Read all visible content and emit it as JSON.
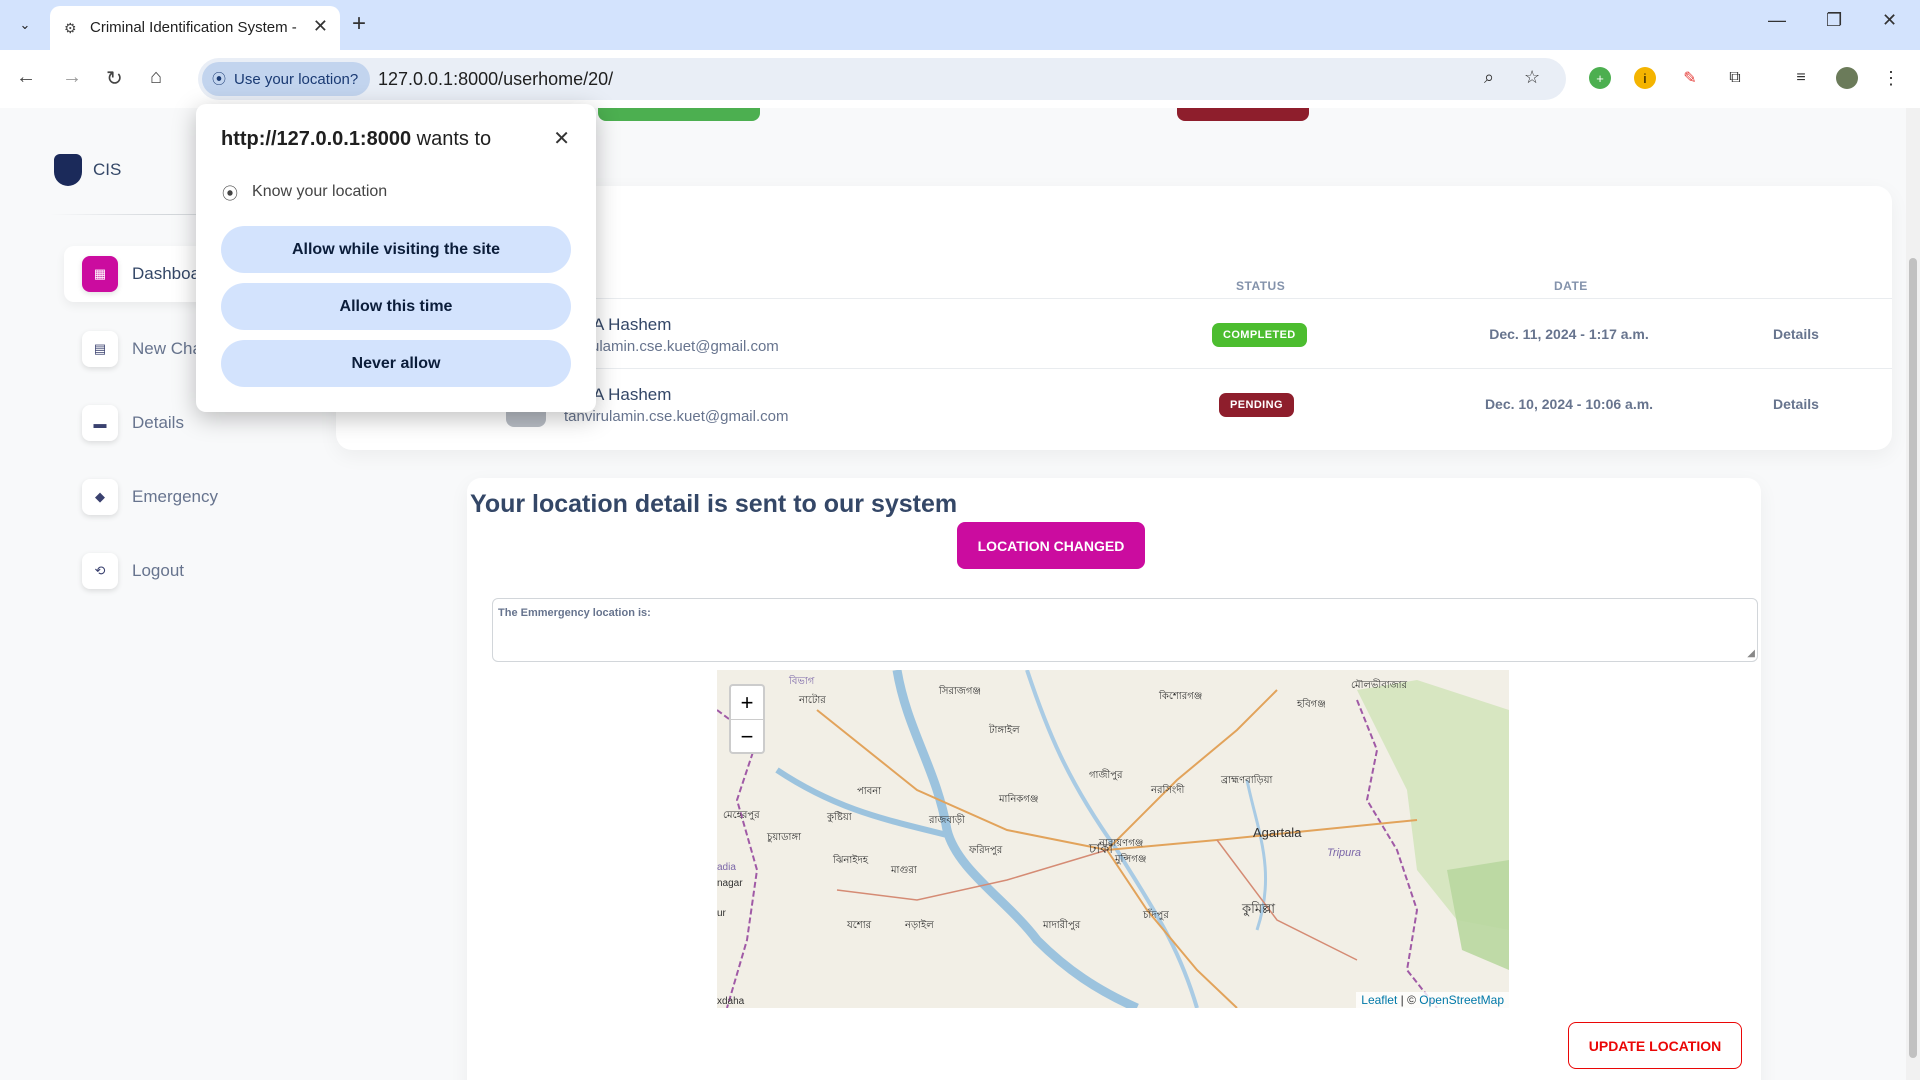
{
  "browser": {
    "tab_title": "Criminal Identification System -",
    "url": "127.0.0.1:8000/userhome/20/",
    "location_chip": "Use your location?"
  },
  "sidebar": {
    "brand": "CIS",
    "items": [
      {
        "label": "Dashboa",
        "icon": "shop-icon",
        "active": true
      },
      {
        "label": "New Cha",
        "icon": "office-icon",
        "active": false
      },
      {
        "label": "Details",
        "icon": "credit-card-icon",
        "active": false
      },
      {
        "label": "Emergency",
        "icon": "box-icon",
        "active": false
      },
      {
        "label": "Logout",
        "icon": "logout-icon",
        "active": false
      }
    ]
  },
  "table": {
    "headers": {
      "status": "STATUS",
      "date": "DATE"
    },
    "rows": [
      {
        "name": "A Hashem",
        "email": "rulamin.cse.kuet@gmail.com",
        "status": "COMPLETED",
        "status_color": "#2dce89",
        "date": "Dec. 11, 2024 - 1:17 a.m.",
        "action": "Details"
      },
      {
        "name": "A Hashem",
        "email": "tanvirulamin.cse.kuet@gmail.com",
        "status": "PENDING",
        "status_color": "#8e1e2c",
        "date": "Dec. 10, 2024 - 10:06 a.m.",
        "action": "Details"
      }
    ]
  },
  "location": {
    "heading": "Your location detail is sent to our system",
    "changed_button": "LOCATION CHANGED",
    "textarea_text": "The Emmergency location is:",
    "update_button": "UPDATE LOCATION"
  },
  "map": {
    "zoom_in": "+",
    "zoom_out": "−",
    "labels": [
      "Agartala",
      "Tripura",
      "ঢাকা",
      "কুমিল্লা",
      "পাবনা",
      "কুষ্টিয়া",
      "টাঙ্গাইল",
      "নাটোর",
      "সিরাজগঞ্জ",
      "কিশোরগঞ্জ",
      "হবিগঞ্জ",
      "মৌলভীবাজার",
      "গাজীপুর",
      "নরসিংদী",
      "ব্রাহ্মণবাড়িয়া",
      "মানিকগঞ্জ",
      "রাজবাড়ী",
      "ফরিদপুর",
      "নারায়ণগঞ্জ",
      "মুন্সিগঞ্জ",
      "ঝিনাইদহ",
      "মাগুরা",
      "চুয়াডাঙ্গা",
      "মেহেরপুর",
      "চাঁদপুর",
      "যশোর",
      "নড়াইল",
      "মাদারীপুর",
      "বিভাগ",
      "nagar",
      "adia",
      "ur",
      "xdaha"
    ],
    "attribution_leaflet": "Leaflet",
    "attribution_sep": " | © ",
    "attribution_osm": "OpenStreetMap"
  },
  "popup": {
    "origin": "http://127.0.0.1:8000",
    "wants_to": " wants to",
    "permission": "Know your location",
    "buttons": [
      "Allow while visiting the site",
      "Allow this time",
      "Never allow"
    ]
  },
  "colors": {
    "primary": "#cb0c9f",
    "danger": "#ea0606",
    "success": "#2dce89"
  }
}
